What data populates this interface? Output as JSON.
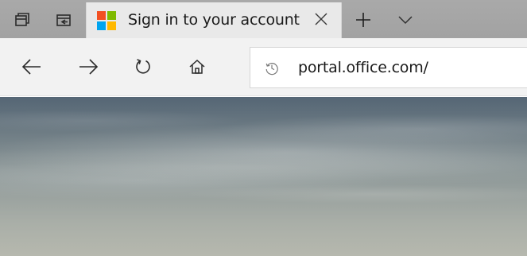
{
  "tabs": [
    {
      "title": "Sign in to your account",
      "active": true
    }
  ],
  "address_bar": {
    "url": "portal.office.com/"
  },
  "icons": {
    "tab_preview": "tabs-aside-icon",
    "set_aside": "set-tabs-aside-icon",
    "favicon": "microsoft-logo-icon",
    "close": "close-icon",
    "new_tab": "plus-icon",
    "tab_list": "chevron-down-icon",
    "back": "arrow-left-icon",
    "forward": "arrow-right-icon",
    "refresh": "refresh-icon",
    "home": "home-icon",
    "history": "history-icon"
  },
  "colors": {
    "tabstrip_bg": "#a9a9a9",
    "active_tab_bg": "#e9e9e9",
    "navbar_bg": "#f2f2f2",
    "ms_red": "#f25022",
    "ms_green": "#7fba00",
    "ms_blue": "#00a4ef",
    "ms_yellow": "#ffb900"
  }
}
